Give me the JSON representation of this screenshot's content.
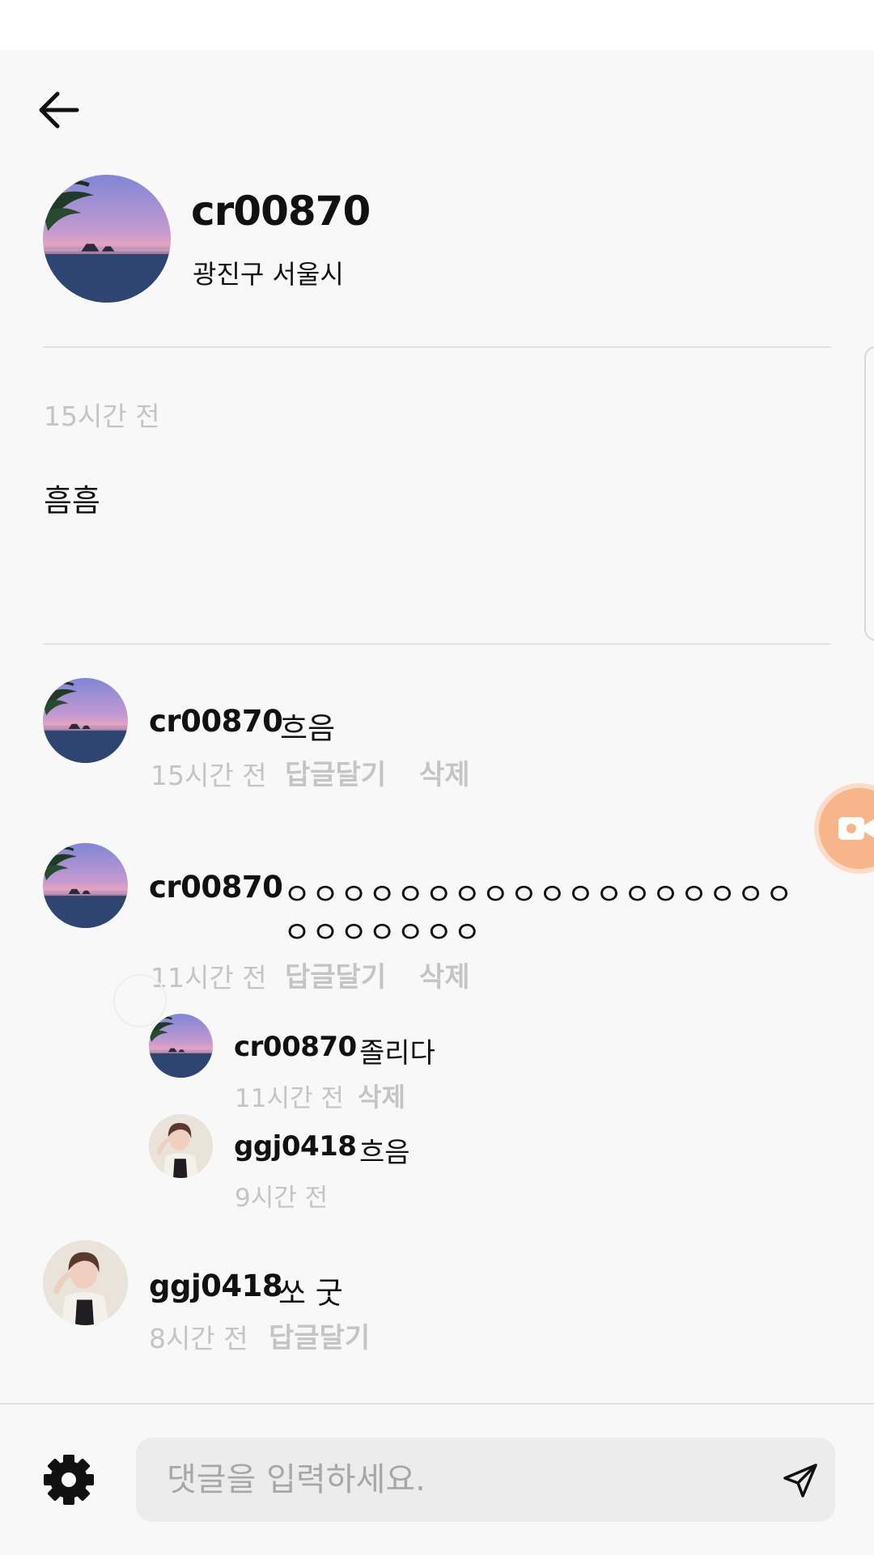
{
  "header": {
    "back_icon": "arrow-left-icon"
  },
  "post": {
    "author": "cr00870",
    "location": "광진구 서울시",
    "time": "15시간 전",
    "body": "흠흠"
  },
  "comments": [
    {
      "author": "cr00870",
      "text": "흐음",
      "time": "15시간 전",
      "reply_label": "답글달기",
      "delete_label": "삭제"
    },
    {
      "author": "cr00870",
      "text_line1": "ㅇㅇㅇㅇㅇㅇㅇㅇㅇㅇㅇㅇㅇㅇㅇㅇㅇㅇ",
      "text_line2": "ㅇㅇㅇㅇㅇㅇㅇ",
      "time": "11시간 전",
      "reply_label": "답글달기",
      "delete_label": "삭제",
      "replies": [
        {
          "author": "cr00870",
          "text": "졸리다",
          "time": "11시간 전",
          "delete_label": "삭제"
        },
        {
          "author": "ggj0418",
          "text": "흐음",
          "time": "9시간 전"
        }
      ]
    },
    {
      "author": "ggj0418",
      "text": "쏘 굿",
      "time": "8시간 전",
      "reply_label": "답글달기"
    }
  ],
  "composer": {
    "placeholder": "댓글을 입력하세요.",
    "settings_icon": "gear-icon",
    "send_icon": "send-icon"
  },
  "colors": {
    "background": "#f8f8f9",
    "muted_text": "#c4c4c6",
    "accent_float": "#f8b58a"
  }
}
